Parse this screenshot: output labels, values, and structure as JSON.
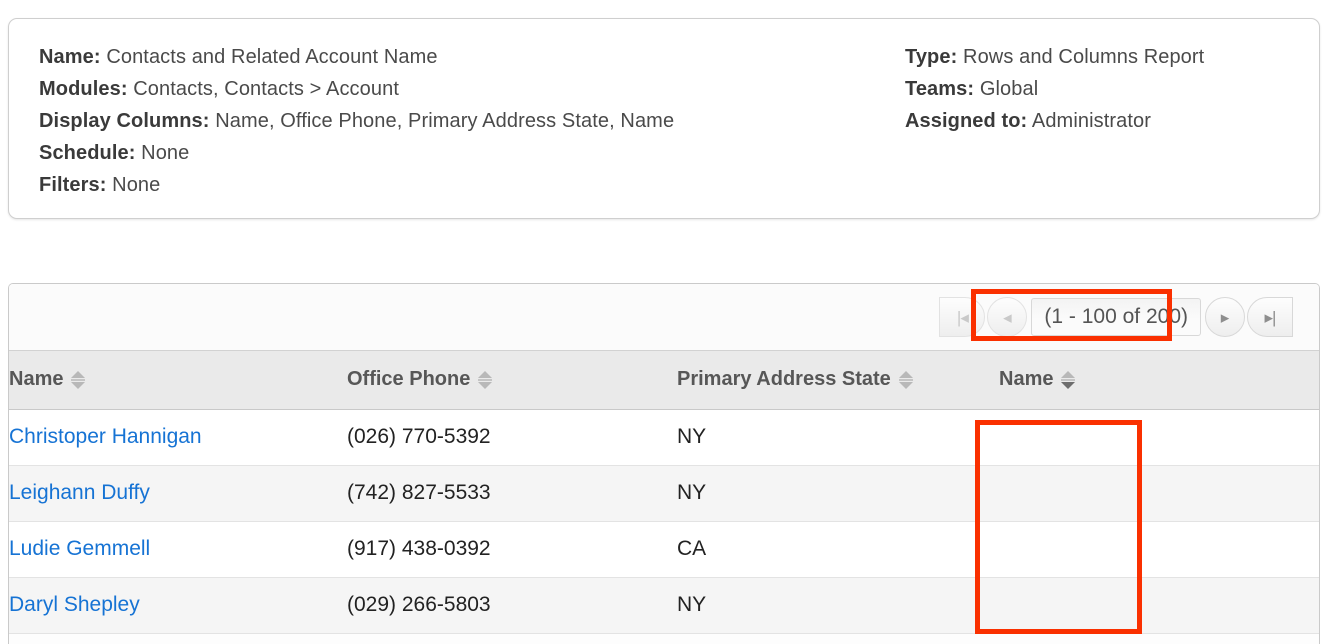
{
  "report_info": {
    "left_rows": [
      {
        "label": "Name:",
        "value": "Contacts and Related Account Name"
      },
      {
        "label": "Modules:",
        "value": "Contacts, Contacts > Account"
      },
      {
        "label": "Display Columns:",
        "value": "Name, Office Phone, Primary Address State, Name"
      },
      {
        "label": "Schedule:",
        "value": "None"
      },
      {
        "label": "Filters:",
        "value": "None"
      }
    ],
    "right_rows": [
      {
        "label": "Type:",
        "value": "Rows and Columns Report"
      },
      {
        "label": "Teams:",
        "value": "Global"
      },
      {
        "label": "Assigned to:",
        "value": "Administrator"
      }
    ]
  },
  "pagination": {
    "first_label": "|◂",
    "prev_label": "◂",
    "count_label": "(1 - 100 of 200)",
    "next_label": "▸",
    "last_label": "▸|",
    "first_enabled": false,
    "prev_enabled": false,
    "next_enabled": true,
    "last_enabled": true
  },
  "table": {
    "columns": [
      {
        "label": "Name",
        "sorted": false
      },
      {
        "label": "Office Phone",
        "sorted": false
      },
      {
        "label": "Primary Address State",
        "sorted": false
      },
      {
        "label": "Name",
        "sorted": true
      }
    ],
    "rows": [
      {
        "name": "Christoper Hannigan",
        "office_phone": "(026) 770-5392",
        "primary_address_state": "NY",
        "account_name": ""
      },
      {
        "name": "Leighann Duffy",
        "office_phone": "(742) 827-5533",
        "primary_address_state": "NY",
        "account_name": ""
      },
      {
        "name": "Ludie Gemmell",
        "office_phone": "(917) 438-0392",
        "primary_address_state": "CA",
        "account_name": ""
      },
      {
        "name": "Daryl Shepley",
        "office_phone": "(029) 266-5803",
        "primary_address_state": "NY",
        "account_name": ""
      }
    ]
  },
  "annotations": {
    "highlight_color": "#fa3000",
    "boxes": [
      {
        "name": "pagination-highlight"
      },
      {
        "name": "empty-name-column-highlight"
      }
    ]
  }
}
